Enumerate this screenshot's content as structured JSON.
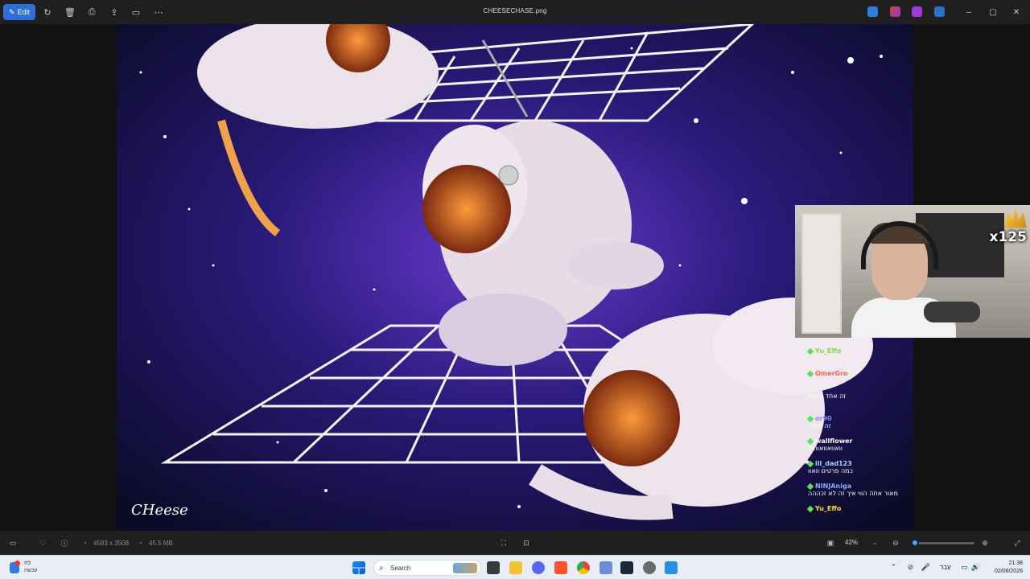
{
  "window": {
    "title": "CHEESECHASE.png",
    "edit_label": "Edit"
  },
  "image": {
    "signature_text": "CHeese"
  },
  "overlay": {
    "multiplier": "x125",
    "chat": [
      {
        "user": "Yu_Effo",
        "color": "#7fdc3c",
        "message": ""
      },
      {
        "user": "OmerGro",
        "color": "#ff5a5a",
        "message": ""
      },
      {
        "user": "",
        "color": "#ff3a6a",
        "message": "זה אחד היפים"
      },
      {
        "user": "or90",
        "color": "#8a8aff",
        "message": "זה פסיכי"
      },
      {
        "user": "wallflower",
        "color": "#ffffff",
        "message": "וואוואוואוו!!!"
      },
      {
        "user": "ill_dad123",
        "color": "#a0d8ff",
        "message": "כמה פרטים וואוו"
      },
      {
        "user": "NINJAniga",
        "color": "#7fb0ff",
        "message": "מאור אתה הווי איך זה לא זכההה"
      },
      {
        "user": "Yu_Effo",
        "color": "#ffdf40",
        "message": ""
      }
    ]
  },
  "statusbar": {
    "dimensions": "4583 x 3508",
    "file_size": "45.5 MB",
    "zoom": "42%",
    "zoom_fraction": 0.05
  },
  "taskbar": {
    "search_placeholder": "Search",
    "weather_line1": "לח",
    "weather_line2": "עכשיו",
    "language": "עבר",
    "time": "21:38",
    "date": "02/08/2026"
  },
  "colors": {
    "accent": "#2d6fd6",
    "slider": "#4aa2ff"
  }
}
